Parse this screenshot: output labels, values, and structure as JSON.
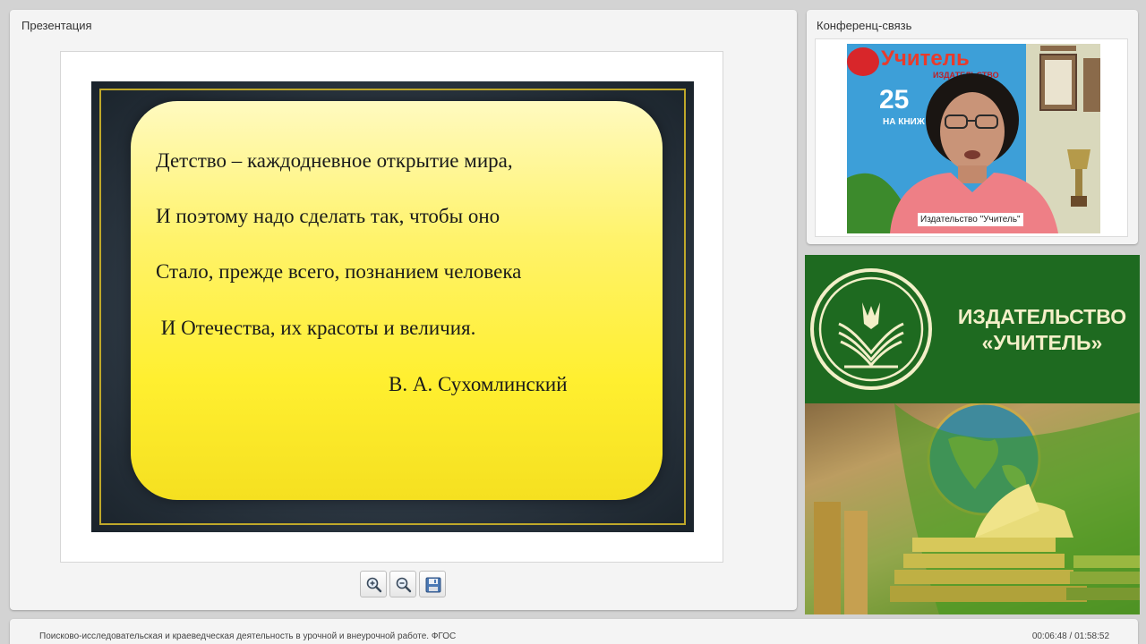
{
  "presentation": {
    "title": "Презентация",
    "slide": {
      "quote_lines": [
        "Детство – каждодневное открытие мира,",
        "И поэтому надо сделать так, чтобы оно",
        "Стало, прежде всего, познанием человека",
        " И Отечества, их красоты и величия."
      ],
      "author": "В. А. Сухомлинский"
    },
    "tools": {
      "zoom_in_icon": "zoom-in-icon",
      "zoom_out_icon": "zoom-out-icon",
      "save_icon": "save-icon"
    }
  },
  "conference": {
    "title": "Конференц-связь",
    "video_caption": "Издательство \"Учитель\"",
    "backdrop_text": {
      "brand": "Учитель",
      "sub": "ИЗДАТЕЛЬСТВО",
      "number": "25",
      "tagline": "НА КНИЖ"
    }
  },
  "banner": {
    "line1": "ИЗДАТЕЛЬСТВО",
    "line2": "«УЧИТЕЛЬ»"
  },
  "footer": {
    "course_title": "Поисково-исследовательская и краеведческая деятельность в урочной и внеурочной работе. ФГОС",
    "time": "00:06:48 / 01:58:52"
  },
  "colors": {
    "banner_green": "#1e6a20",
    "banner_text": "#f3efc8",
    "slide_yellow": "#fff36a",
    "slide_frame_gold": "#bfa82a"
  }
}
